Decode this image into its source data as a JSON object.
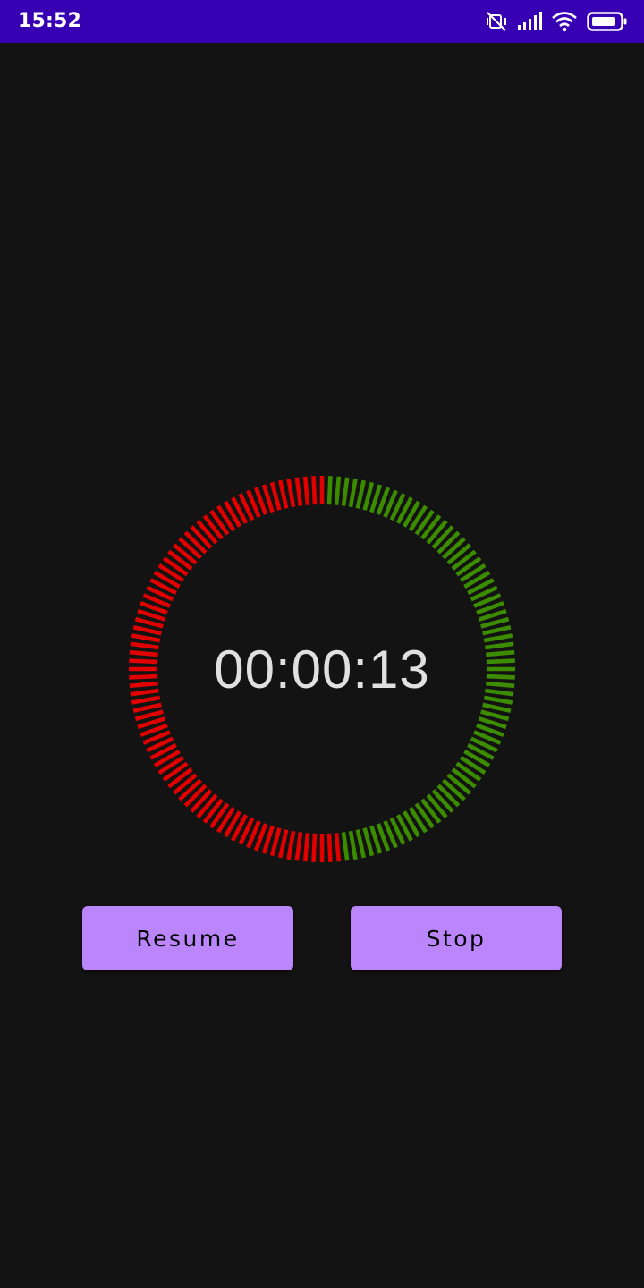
{
  "status_bar": {
    "time": "15:52",
    "icons": [
      "vibrate-icon",
      "signal-icon",
      "wifi-icon",
      "battery-icon"
    ],
    "background": "#3700b3"
  },
  "timer": {
    "display": "00:00:13",
    "progress_elapsed_fraction": 0.52,
    "elapsed_color": "#e00000",
    "remaining_color": "#3c8c00"
  },
  "buttons": {
    "resume_label": "Resume",
    "stop_label": "Stop",
    "color": "#bb86fc"
  }
}
